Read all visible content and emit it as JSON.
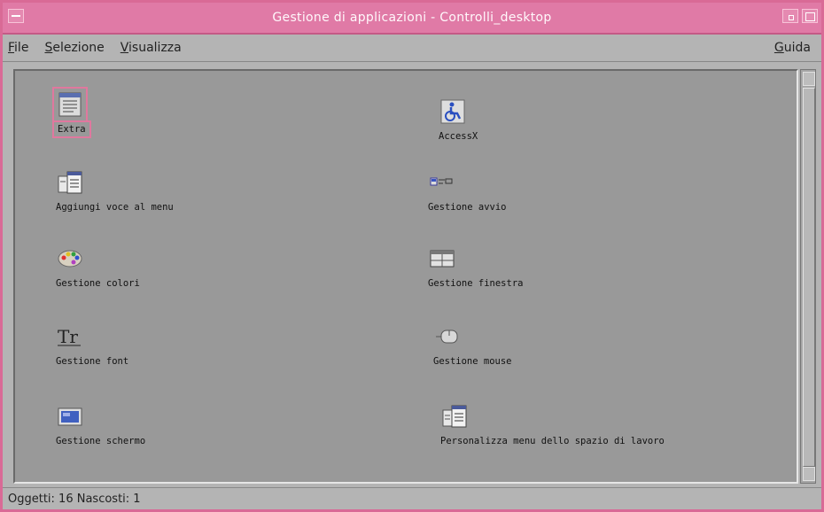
{
  "window": {
    "title": "Gestione di applicazioni - Controlli_desktop",
    "accent_color": "#e07aa6"
  },
  "menubar": {
    "items": [
      {
        "label": "File",
        "mnemonic": "F"
      },
      {
        "label": "Selezione",
        "mnemonic": "S"
      },
      {
        "label": "Visualizza",
        "mnemonic": "V"
      }
    ],
    "help": {
      "label": "Guida",
      "mnemonic": "G"
    }
  },
  "icons": [
    {
      "label": "Extra",
      "icon": "notebook-icon",
      "selected": true
    },
    {
      "label": "AccessX",
      "icon": "wheelchair-icon",
      "selected": false
    },
    {
      "label": "Aggiungi voce al menu",
      "icon": "menu-add-icon",
      "selected": false
    },
    {
      "label": "Gestione avvio",
      "icon": "startup-icon",
      "selected": false
    },
    {
      "label": "Gestione colori",
      "icon": "palette-icon",
      "selected": false
    },
    {
      "label": "Gestione finestra",
      "icon": "window-icon",
      "selected": false
    },
    {
      "label": "Gestione font",
      "icon": "font-icon",
      "glyph": "Tr",
      "selected": false
    },
    {
      "label": "Gestione mouse",
      "icon": "mouse-icon",
      "selected": false
    },
    {
      "label": "Gestione schermo",
      "icon": "monitor-icon",
      "selected": false
    },
    {
      "label": "Personalizza menu dello spazio di lavoro",
      "icon": "workspace-menu-icon",
      "selected": false
    }
  ],
  "status": {
    "text": "Oggetti: 16 Nascosti: 1"
  }
}
